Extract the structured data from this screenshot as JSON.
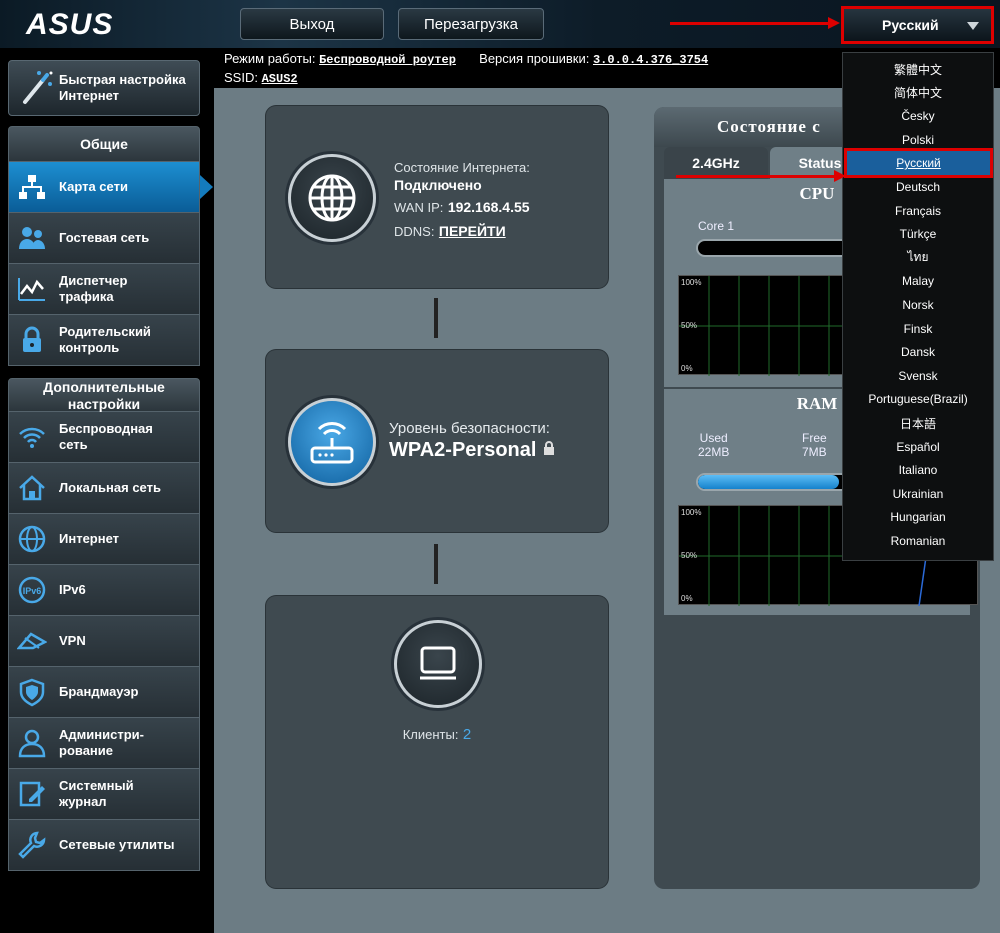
{
  "header": {
    "logo": "ASUS",
    "logout_label": "Выход",
    "reboot_label": "Перезагрузка",
    "language_selected": "Русский"
  },
  "info": {
    "mode_label": "Режим работы:",
    "mode_value": "Беспроводной роутер",
    "firmware_label": "Версия прошивки:",
    "firmware_value": "3.0.0.4.376_3754",
    "ssid_label": "SSID:",
    "ssid_value": "ASUS2"
  },
  "sidebar": {
    "quick_setup_line1": "Быстрая настройка",
    "quick_setup_line2": "Интернет",
    "general_header": "Общие",
    "general_items": [
      {
        "line1": "Карта сети",
        "line2": ""
      },
      {
        "line1": "Гостевая сеть",
        "line2": ""
      },
      {
        "line1": "Диспетчер",
        "line2": "трафика"
      },
      {
        "line1": "Родительский",
        "line2": "контроль"
      }
    ],
    "advanced_header_line1": "Дополнительные",
    "advanced_header_line2": "настройки",
    "advanced_items": [
      {
        "line1": "Беспроводная",
        "line2": "сеть"
      },
      {
        "line1": "Локальная сеть",
        "line2": ""
      },
      {
        "line1": "Интернет",
        "line2": ""
      },
      {
        "line1": "IPv6",
        "line2": ""
      },
      {
        "line1": "VPN",
        "line2": ""
      },
      {
        "line1": "Брандмауэр",
        "line2": ""
      },
      {
        "line1": "Администри-",
        "line2": "рование"
      },
      {
        "line1": "Системный",
        "line2": "журнал"
      },
      {
        "line1": "Сетевые утилиты",
        "line2": ""
      }
    ]
  },
  "internet_card": {
    "status_label": "Состояние Интернета:",
    "status_value": "Подключено",
    "wan_label": "WAN IP:",
    "wan_value": "192.168.4.55",
    "ddns_label": "DDNS:",
    "ddns_link": "ПЕРЕЙТИ"
  },
  "security_card": {
    "label": "Уровень безопасности:",
    "value": "WPA2-Personal"
  },
  "clients_card": {
    "label": "Клиенты:",
    "count": "2"
  },
  "status_panel": {
    "title": "Состояние с",
    "tab_band": "2.4GHz",
    "tab_status": "Status",
    "cpu_title": "CPU",
    "core_label": "Core 1",
    "ram_title": "RAM",
    "used_label": "Used",
    "used_value": "22MB",
    "free_label": "Free",
    "free_value": "7MB",
    "ram_used_fraction": 0.76,
    "graph_labels": [
      "100%",
      "50%",
      "0%"
    ]
  },
  "languages": [
    "繁體中文",
    "简体中文",
    "Česky",
    "Polski",
    "Русский",
    "Deutsch",
    "Français",
    "Türkçe",
    "ไทย",
    "Malay",
    "Norsk",
    "Finsk",
    "Dansk",
    "Svensk",
    "Portuguese(Brazil)",
    "日本語",
    "Español",
    "Italiano",
    "Ukrainian",
    "Hungarian",
    "Romanian"
  ],
  "colors": {
    "accent": "#1a8ad0",
    "highlight": "#dd0000",
    "link": "#49a9e8"
  }
}
